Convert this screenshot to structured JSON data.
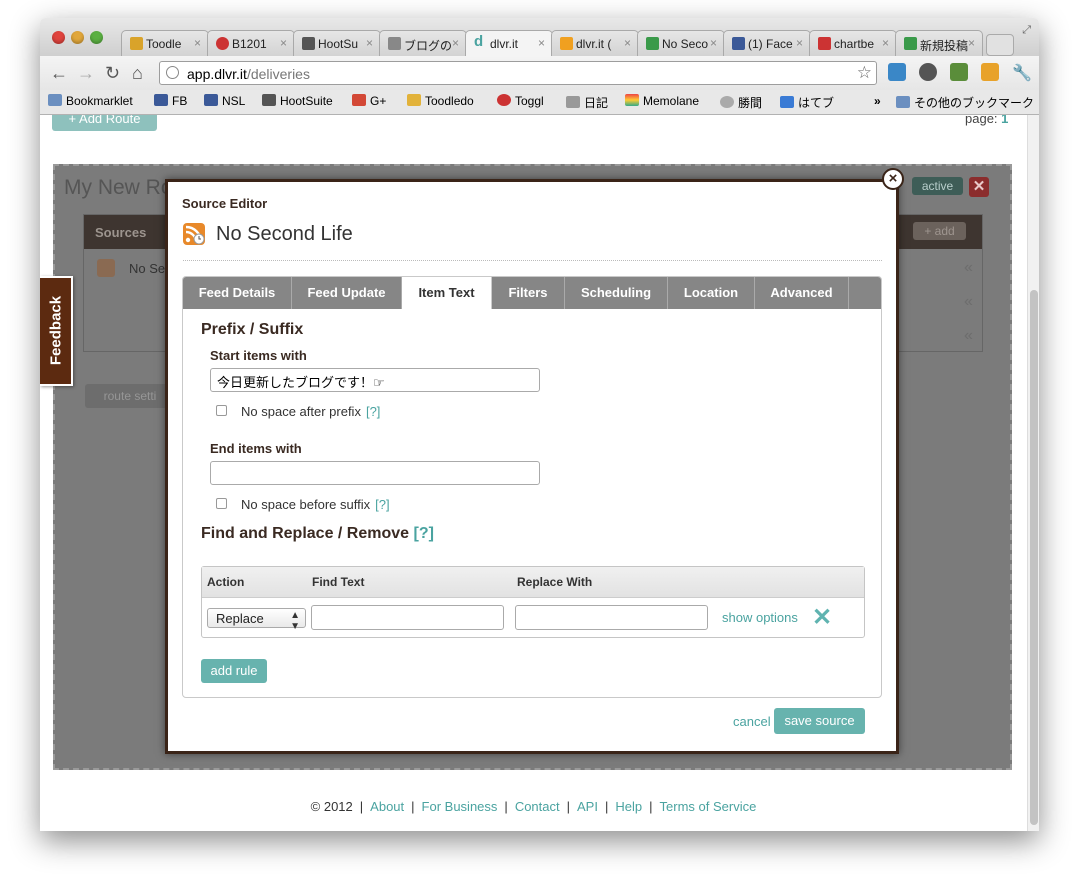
{
  "browser": {
    "tabs": [
      {
        "label": "Toodle",
        "icon_color": "#d9a32a"
      },
      {
        "label": "B1201",
        "icon_color": "#cc3333"
      },
      {
        "label": "HootSu",
        "icon_color": "#555555"
      },
      {
        "label": "ブログの",
        "icon_color": "#888888"
      },
      {
        "label": "dlvr.it",
        "icon_color": "#4aa3a0",
        "active": true
      },
      {
        "label": "dlvr.it (",
        "icon_color": "#f0a020"
      },
      {
        "label": "No Seco",
        "icon_color": "#3a9a4a"
      },
      {
        "label": "(1) Face",
        "icon_color": "#3b5998"
      },
      {
        "label": "chartbe",
        "icon_color": "#cc3333"
      },
      {
        "label": "新規投稿",
        "icon_color": "#3a9a4a"
      }
    ],
    "tab_close": "×",
    "url_host": "app.dlvr.it",
    "url_path": "/deliveries",
    "bookmarks": [
      {
        "label": "Bookmarklet",
        "icon": "folder-icon"
      },
      {
        "label": "FB",
        "icon": "facebook-icon"
      },
      {
        "label": "NSL",
        "icon": "facebook-icon"
      },
      {
        "label": "HootSuite",
        "icon": "hootsuite-icon"
      },
      {
        "label": "G+",
        "icon": "gplus-icon"
      },
      {
        "label": "Toodledo",
        "icon": "check-icon"
      },
      {
        "label": "Toggl",
        "icon": "toggl-icon"
      },
      {
        "label": "日記",
        "icon": "grid-icon"
      },
      {
        "label": "Memolane",
        "icon": "memolane-icon"
      },
      {
        "label": "勝間",
        "icon": "globe-icon"
      },
      {
        "label": "はてブ",
        "icon": "hatena-icon"
      }
    ],
    "bookmarks_overflow": "»",
    "other_bookmarks": "その他のブックマーク"
  },
  "page": {
    "add_route": "+ Add Route",
    "page_label": "page:",
    "page_number": "1",
    "route_name": "My New Ro",
    "route_status": "active",
    "route_delete": "✕",
    "sources_header": "Sources",
    "sources_add": "+ add",
    "source_row": "No Se",
    "route_settings": "route setti",
    "feedback": "Feedback",
    "chevrons": [
      "«",
      "«",
      "«"
    ]
  },
  "modal": {
    "close": "×",
    "subtitle": "Source Editor",
    "title": "No Second Life",
    "tabs": [
      "Feed Details",
      "Feed Update",
      "Item Text",
      "Filters",
      "Scheduling",
      "Location",
      "Advanced"
    ],
    "active_tab": "Item Text",
    "prefix_suffix_title": "Prefix / Suffix",
    "start_label": "Start items with",
    "start_value": "今日更新したブログです！☞",
    "no_space_prefix": "No space after prefix",
    "help": "[?]",
    "end_label": "End items with",
    "end_value": "",
    "no_space_suffix": "No space before suffix",
    "find_replace_title": "Find and Replace / Remove",
    "rules_headers": {
      "action": "Action",
      "find": "Find Text",
      "replace": "Replace With"
    },
    "rule_action": "Replace",
    "show_options": "show options",
    "rule_delete": "✕",
    "add_rule": "add rule",
    "cancel": "cancel",
    "save": "save source"
  },
  "footer": {
    "copyright": "© 2012",
    "links": [
      "About",
      "For Business",
      "Contact",
      "API",
      "Help",
      "Terms of Service"
    ]
  },
  "colors": {
    "accent": "#4aa3a0",
    "button": "#67b3ae",
    "modal_border": "#3a2418"
  }
}
